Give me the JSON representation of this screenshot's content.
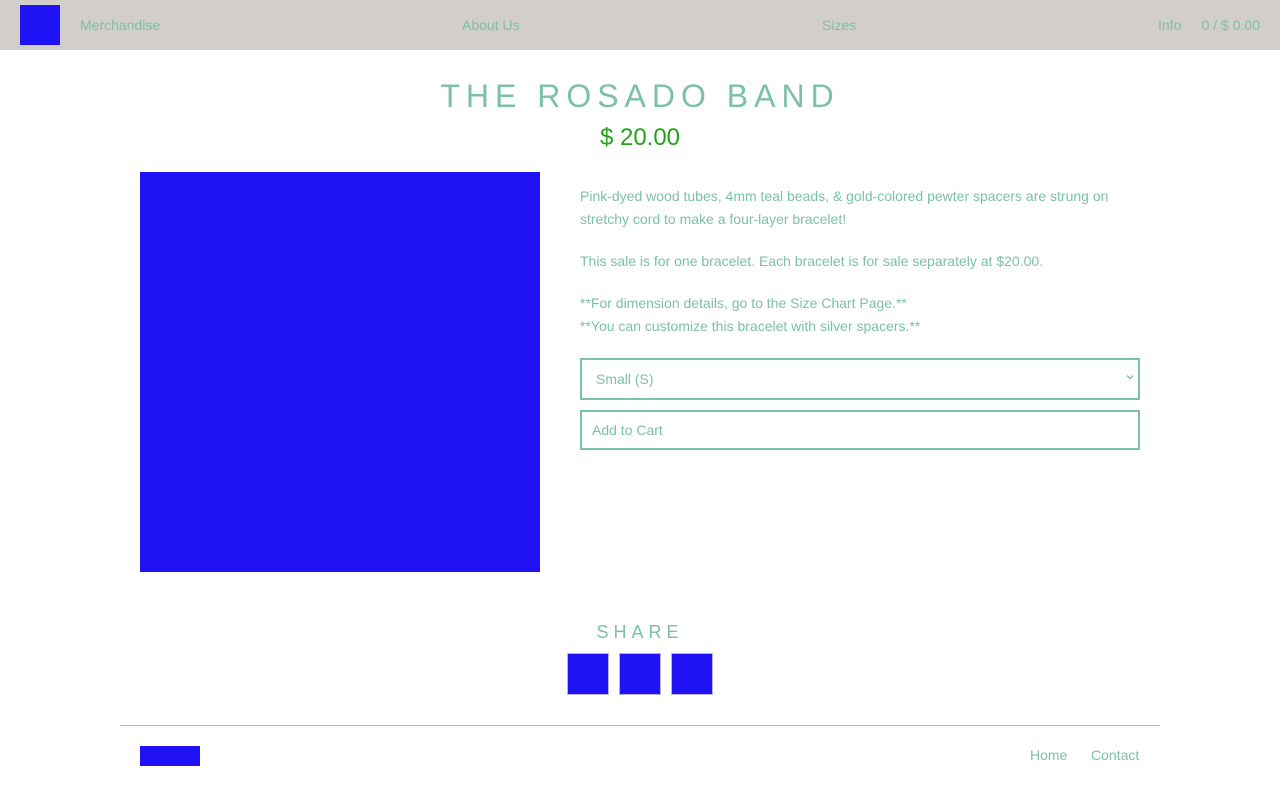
{
  "header": {
    "nav": {
      "merchandise": "Merchandise",
      "about": "About Us",
      "sizes": "Sizes",
      "info": "Info",
      "cart": "0 / $ 0.00"
    }
  },
  "product": {
    "title": "THE ROSADO BAND",
    "price": "$ 20.00",
    "description": {
      "p1": "Pink-dyed wood tubes, 4mm teal beads, & gold-colored pewter spacers are strung on stretchy cord to make a four-layer bracelet!",
      "p2": "This sale is for one bracelet. Each bracelet is for sale separately at $20.00.",
      "p3_line1": "**For dimension details, go to the Size Chart Page.**",
      "p3_line2": "**You can customize this bracelet with silver spacers.**"
    },
    "size_selected": "Small (S)",
    "add_to_cart": "Add to Cart"
  },
  "share": {
    "heading": "SHARE"
  },
  "footer": {
    "home": "Home",
    "contact": "Contact"
  },
  "colors": {
    "accent": "#7cc0aa",
    "price": "#22a318",
    "placeholder": "#1f12f5",
    "topbar": "#d2ceca"
  }
}
